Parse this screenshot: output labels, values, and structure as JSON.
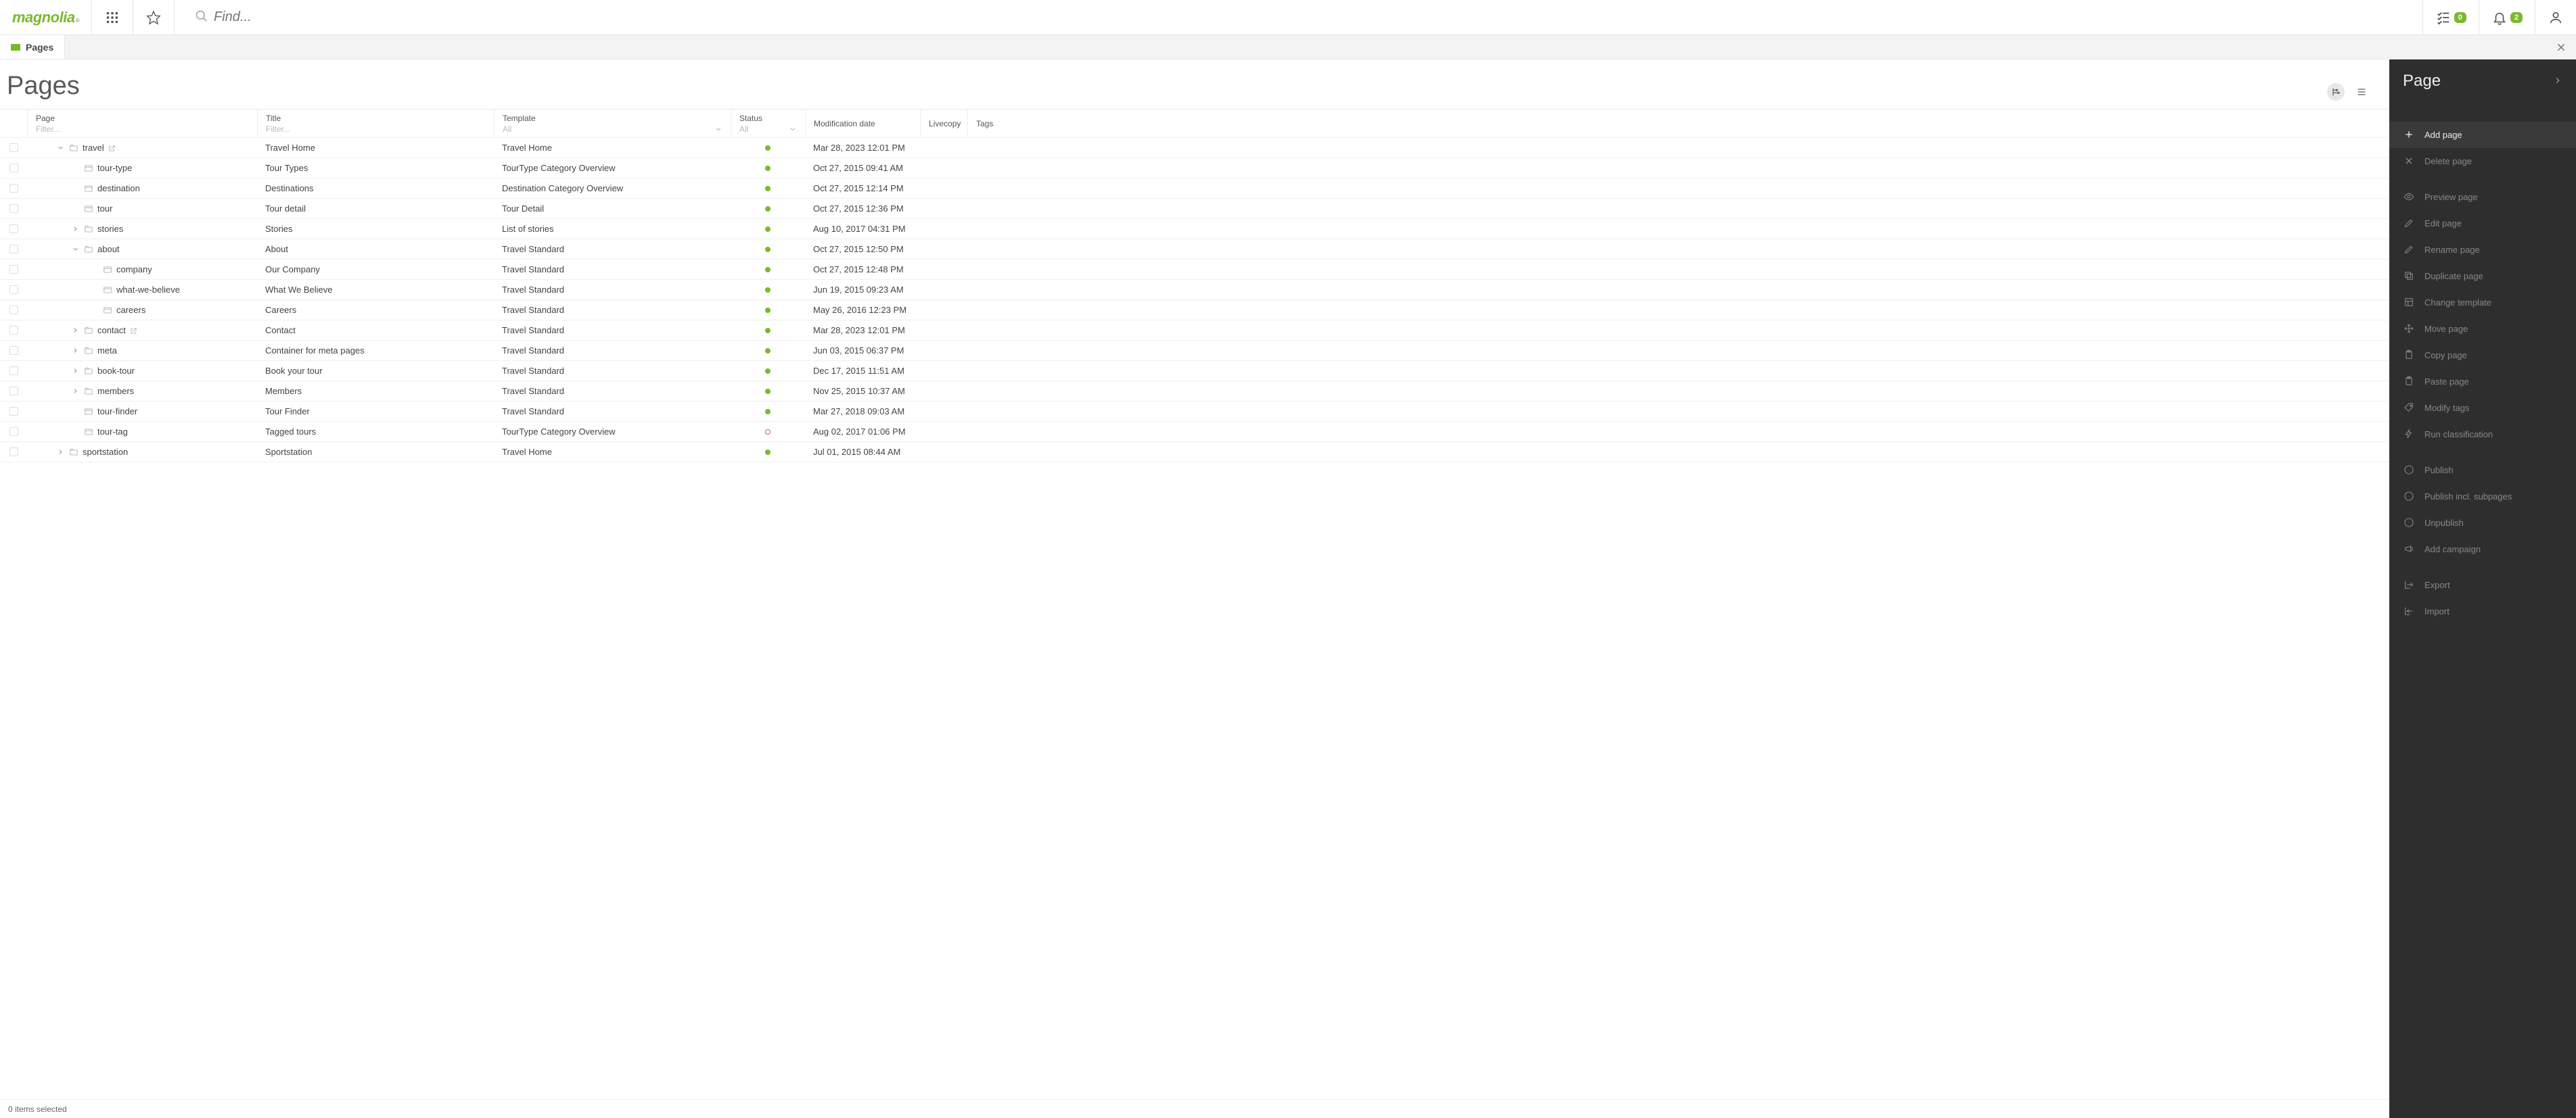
{
  "logo": "magnolia",
  "search": {
    "placeholder": "Find..."
  },
  "task_badge": "0",
  "notif_badge": "2",
  "apptab": {
    "label": "Pages"
  },
  "page_title": "Pages",
  "columns": {
    "page": "Page",
    "page_filter": "Filter...",
    "title": "Title",
    "title_filter": "Filter...",
    "template": "Template",
    "template_filter": "All",
    "status": "Status",
    "status_filter": "All",
    "moddate": "Modification date",
    "livecopy": "Livecopy",
    "tags": "Tags"
  },
  "rows": [
    {
      "indent": 0,
      "expand": "open",
      "icon": "folder",
      "name": "travel",
      "ext": true,
      "title": "Travel Home",
      "template": "Travel Home",
      "status": "pub",
      "date": "Mar 28, 2023 12:01 PM"
    },
    {
      "indent": 1,
      "expand": "",
      "icon": "page",
      "name": "tour-type",
      "title": "Tour Types",
      "template": "TourType Category Overview",
      "status": "pub",
      "date": "Oct 27, 2015 09:41 AM"
    },
    {
      "indent": 1,
      "expand": "",
      "icon": "page",
      "name": "destination",
      "title": "Destinations",
      "template": "Destination Category Overview",
      "status": "pub",
      "date": "Oct 27, 2015 12:14 PM"
    },
    {
      "indent": 1,
      "expand": "",
      "icon": "page",
      "name": "tour",
      "title": "Tour detail",
      "template": "Tour Detail",
      "status": "pub",
      "date": "Oct 27, 2015 12:36 PM"
    },
    {
      "indent": 1,
      "expand": "closed",
      "icon": "folder",
      "name": "stories",
      "title": "Stories",
      "template": "List of stories",
      "status": "pub",
      "date": "Aug 10, 2017 04:31 PM"
    },
    {
      "indent": 1,
      "expand": "open",
      "icon": "folder",
      "name": "about",
      "title": "About",
      "template": "Travel Standard",
      "status": "pub",
      "date": "Oct 27, 2015 12:50 PM"
    },
    {
      "indent": 2,
      "expand": "",
      "icon": "page",
      "name": "company",
      "title": "Our Company",
      "template": "Travel Standard",
      "status": "pub",
      "date": "Oct 27, 2015 12:48 PM"
    },
    {
      "indent": 2,
      "expand": "",
      "icon": "page",
      "name": "what-we-believe",
      "title": "What We Believe",
      "template": "Travel Standard",
      "status": "pub",
      "date": "Jun 19, 2015 09:23 AM"
    },
    {
      "indent": 2,
      "expand": "",
      "icon": "page",
      "name": "careers",
      "title": "Careers",
      "template": "Travel Standard",
      "status": "pub",
      "date": "May 26, 2016 12:23 PM"
    },
    {
      "indent": 1,
      "expand": "closed",
      "icon": "folder",
      "name": "contact",
      "ext": true,
      "title": "Contact",
      "template": "Travel Standard",
      "status": "pub",
      "date": "Mar 28, 2023 12:01 PM"
    },
    {
      "indent": 1,
      "expand": "closed",
      "icon": "folder",
      "name": "meta",
      "title": "Container for meta pages",
      "template": "Travel Standard",
      "status": "pub",
      "date": "Jun 03, 2015 06:37 PM"
    },
    {
      "indent": 1,
      "expand": "closed",
      "icon": "folder",
      "name": "book-tour",
      "title": "Book your tour",
      "template": "Travel Standard",
      "status": "pub",
      "date": "Dec 17, 2015 11:51 AM"
    },
    {
      "indent": 1,
      "expand": "closed",
      "icon": "folder",
      "name": "members",
      "title": "Members",
      "template": "Travel Standard",
      "status": "pub",
      "date": "Nov 25, 2015 10:37 AM"
    },
    {
      "indent": 1,
      "expand": "",
      "icon": "page",
      "name": "tour-finder",
      "title": "Tour Finder",
      "template": "Travel Standard",
      "status": "pub",
      "date": "Mar 27, 2018 09:03 AM"
    },
    {
      "indent": 1,
      "expand": "",
      "icon": "page",
      "name": "tour-tag",
      "title": "Tagged tours",
      "template": "TourType Category Overview",
      "status": "unpub",
      "date": "Aug 02, 2017 01:06 PM"
    },
    {
      "indent": 0,
      "expand": "closed",
      "icon": "folder",
      "name": "sportstation",
      "title": "Sportstation",
      "template": "Travel Home",
      "status": "pub",
      "date": "Jul 01, 2015 08:44 AM"
    }
  ],
  "sidepanel": {
    "title": "Page",
    "actions": [
      {
        "label": "Add page",
        "enabled": true,
        "gapAfter": false,
        "icon": "plus"
      },
      {
        "label": "Delete page",
        "enabled": false,
        "gapAfter": true,
        "icon": "x"
      },
      {
        "label": "Preview page",
        "enabled": false,
        "gapAfter": false,
        "icon": "eye"
      },
      {
        "label": "Edit page",
        "enabled": false,
        "gapAfter": false,
        "icon": "pencil"
      },
      {
        "label": "Rename page",
        "enabled": false,
        "gapAfter": false,
        "icon": "pencil"
      },
      {
        "label": "Duplicate page",
        "enabled": false,
        "gapAfter": false,
        "icon": "copy"
      },
      {
        "label": "Change template",
        "enabled": false,
        "gapAfter": false,
        "icon": "template"
      },
      {
        "label": "Move page",
        "enabled": false,
        "gapAfter": false,
        "icon": "move"
      },
      {
        "label": "Copy page",
        "enabled": false,
        "gapAfter": false,
        "icon": "clipboard"
      },
      {
        "label": "Paste page",
        "enabled": false,
        "gapAfter": false,
        "icon": "clipboard"
      },
      {
        "label": "Modify tags",
        "enabled": false,
        "gapAfter": false,
        "icon": "tag"
      },
      {
        "label": "Run classification",
        "enabled": false,
        "gapAfter": true,
        "icon": "bolt"
      },
      {
        "label": "Publish",
        "enabled": false,
        "gapAfter": false,
        "icon": "info"
      },
      {
        "label": "Publish incl. subpages",
        "enabled": false,
        "gapAfter": false,
        "icon": "info"
      },
      {
        "label": "Unpublish",
        "enabled": false,
        "gapAfter": false,
        "icon": "info"
      },
      {
        "label": "Add campaign",
        "enabled": false,
        "gapAfter": true,
        "icon": "campaign"
      },
      {
        "label": "Export",
        "enabled": false,
        "gapAfter": false,
        "icon": "export"
      },
      {
        "label": "Import",
        "enabled": false,
        "gapAfter": false,
        "icon": "import"
      }
    ]
  },
  "footer": "0 items selected"
}
